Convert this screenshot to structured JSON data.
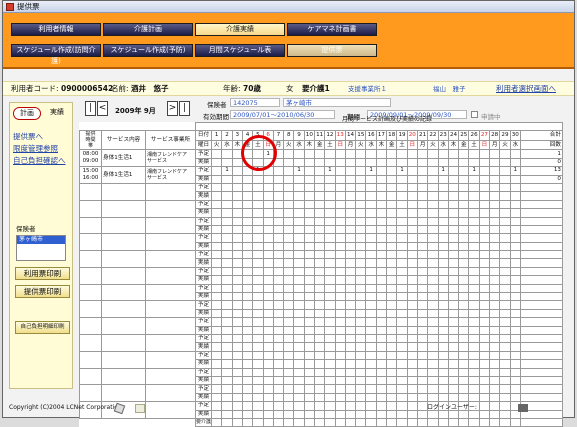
{
  "title": "提供票",
  "nav": {
    "row1": [
      "利用者情報",
      "介護計画",
      "介護実績",
      "ケアマネ計画書"
    ],
    "row2": [
      "スケジュール作成(訪問介護)",
      "スケジュール作成(予防)",
      "月間スケジュール表",
      "提供票"
    ]
  },
  "info": {
    "code_label": "利用者コード:",
    "code": "0900006542",
    "name_label": "名前:",
    "name": "酒井　悠子",
    "age_label": "年齢:",
    "age": "70歳",
    "gender": "女",
    "care": "要介護1",
    "office": "支援事業所１",
    "manager": "福山　雅子",
    "select_link": "利用者選択画面へ"
  },
  "left": {
    "tab_plan": "計画",
    "tab_actual": "実績",
    "link1": "提供票へ",
    "link2": "限度管理参照",
    "link3": "自己負担確認へ",
    "insurer_label": "保険者",
    "insurer_item": "茅ヶ崎市",
    "btn_print_use": "利用票印刷",
    "btn_print_offer": "提供票印刷",
    "btn_print_self": "自己負担明細印刷"
  },
  "main": {
    "month": "2009年 9月",
    "insurer_label": "保険者",
    "insurer_no": "142075",
    "insurer_name": "茅ヶ崎市",
    "valid_label": "有効期間",
    "valid": "2009/07/01～2010/06/30",
    "period_label": "期間",
    "period": "2009/09/01～2009/09/30",
    "applying": "申請中",
    "table_title": "月間サービス計画及び実績の記録"
  },
  "headers": {
    "time": "提供\n時間\n帯",
    "service": "サービス内容",
    "provider": "サービス事業所",
    "day_label": "日付",
    "weekday_label": "曜日",
    "total": "合計",
    "count": "回数",
    "plan": "予定",
    "actual": "実績",
    "total_units": "要介護度"
  },
  "days": [
    "1",
    "2",
    "3",
    "4",
    "5",
    "6",
    "7",
    "8",
    "9",
    "10",
    "11",
    "12",
    "13",
    "14",
    "15",
    "16",
    "17",
    "18",
    "19",
    "20",
    "21",
    "22",
    "23",
    "24",
    "25",
    "26",
    "27",
    "28",
    "29",
    "30"
  ],
  "weekdays": [
    "火",
    "水",
    "木",
    "金",
    "土",
    "日",
    "月",
    "火",
    "水",
    "木",
    "金",
    "土",
    "日",
    "月",
    "火",
    "水",
    "木",
    "金",
    "土",
    "日",
    "月",
    "火",
    "水",
    "木",
    "金",
    "土",
    "日",
    "月",
    "火",
    "水"
  ],
  "rows": [
    {
      "time": "08:00\n09:00",
      "service": "身体1生活1",
      "provider": "湘南フレンドケア\nサービス",
      "plan": [
        0,
        0,
        0,
        0,
        0,
        0,
        0,
        0,
        0,
        0,
        0,
        0,
        0,
        0,
        0,
        0,
        0,
        0,
        0,
        0,
        0,
        0,
        0,
        0,
        0,
        0,
        0,
        0,
        0,
        0
      ],
      "plan_marks": {
        "5": "1"
      },
      "plan_total": "1",
      "actual_total": "0"
    },
    {
      "time": "15:00\n16:00",
      "service": "身体1生活1",
      "provider": "湘南フレンドケア\nサービス",
      "plan_marks": {
        "1": "1",
        "4": "1",
        "8": "1",
        "11": "1",
        "15": "1",
        "18": "1",
        "22": "1",
        "25": "1",
        "29": "1"
      },
      "plan_total": "13",
      "actual_total": "0"
    }
  ],
  "footer": {
    "copyright": "Copyright (C)2004 LCNet Corporation",
    "login": "ログインユーザー:"
  }
}
